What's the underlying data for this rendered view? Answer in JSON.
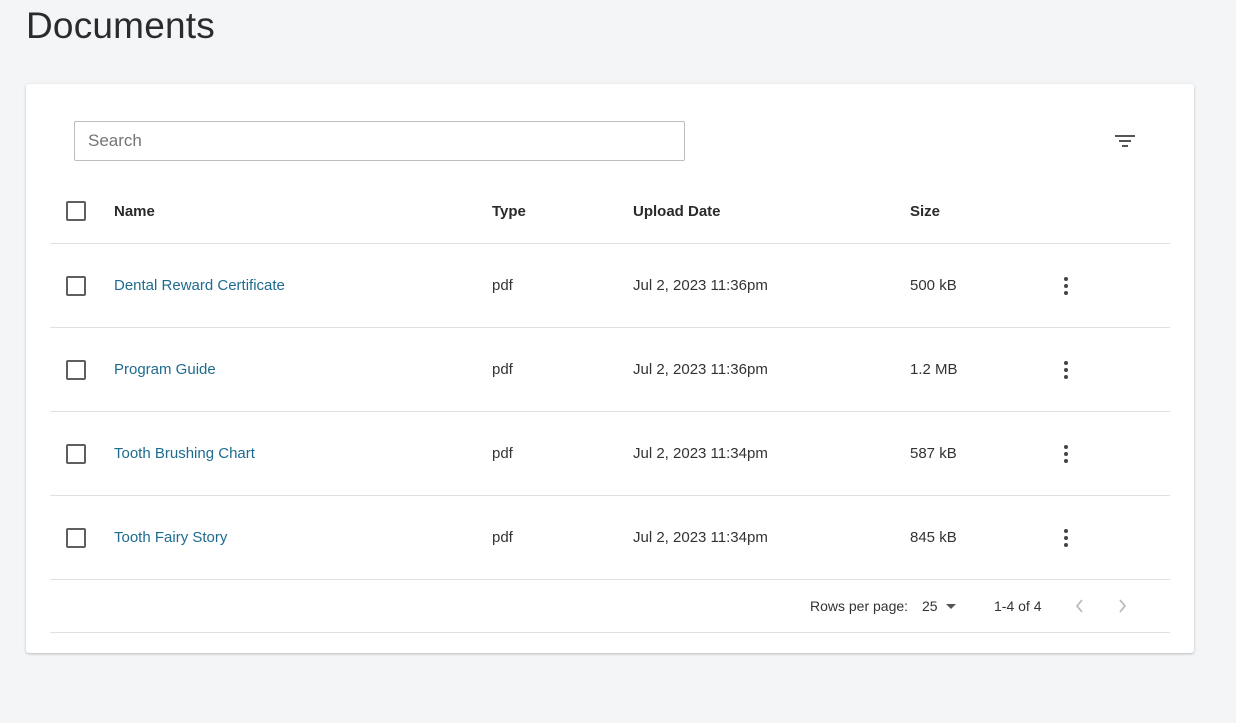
{
  "page": {
    "title": "Documents"
  },
  "search": {
    "placeholder": "Search",
    "value": ""
  },
  "toolbar": {
    "filter_icon": "filter-list-icon"
  },
  "table": {
    "columns": {
      "name": "Name",
      "type": "Type",
      "upload_date": "Upload Date",
      "size": "Size"
    },
    "rows": [
      {
        "name": "Dental Reward Certificate",
        "type": "pdf",
        "upload_date": "Jul 2, 2023 11:36pm",
        "size": "500 kB"
      },
      {
        "name": "Program Guide",
        "type": "pdf",
        "upload_date": "Jul 2, 2023 11:36pm",
        "size": "1.2 MB"
      },
      {
        "name": "Tooth Brushing Chart",
        "type": "pdf",
        "upload_date": "Jul 2, 2023 11:34pm",
        "size": "587 kB"
      },
      {
        "name": "Tooth Fairy Story",
        "type": "pdf",
        "upload_date": "Jul 2, 2023 11:34pm",
        "size": "845 kB"
      }
    ]
  },
  "pagination": {
    "rows_per_page_label": "Rows per page:",
    "rows_per_page_value": "25",
    "range_text": "1-4 of 4"
  },
  "colors": {
    "link": "#1e6b8f",
    "background": "#f3f5f7",
    "divider": "#e0e0e0"
  }
}
